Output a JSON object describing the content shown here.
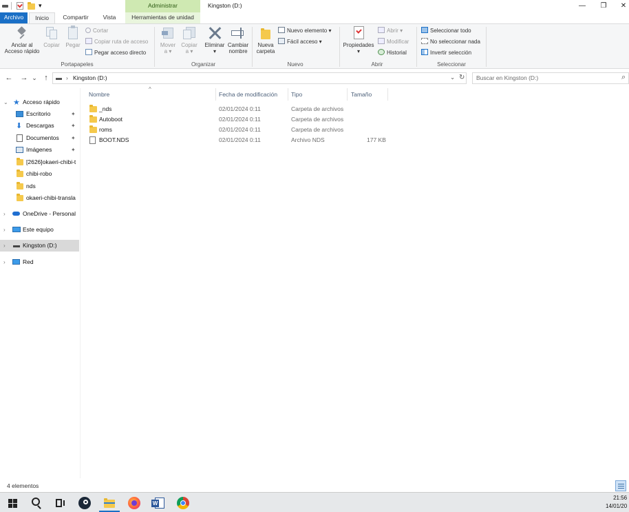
{
  "window": {
    "title": "Kingston (D:)",
    "context_tab_header": "Administrar",
    "minimize_glyph": "—",
    "restore_glyph": "❐",
    "close_glyph": "✕"
  },
  "qat": {
    "dropdown_glyph": "▾"
  },
  "tabs": [
    {
      "label": "Archivo"
    },
    {
      "label": "Inicio"
    },
    {
      "label": "Compartir"
    },
    {
      "label": "Vista"
    },
    {
      "label": "Herramientas de unidad"
    }
  ],
  "ribbon": {
    "clipboard": {
      "pin_label_1": "Anclar al",
      "pin_label_2": "Acceso rápido",
      "copy": "Copiar",
      "paste": "Pegar",
      "cut": "Cortar",
      "copy_path": "Copiar ruta de acceso",
      "paste_shortcut": "Pegar acceso directo",
      "group": "Portapapeles"
    },
    "organize": {
      "move_1": "Mover",
      "move_2": "a ▾",
      "copy_1": "Copiar",
      "copy_2": "a ▾",
      "delete_1": "Eliminar",
      "delete_2": "▾",
      "rename_1": "Cambiar",
      "rename_2": "nombre",
      "group": "Organizar"
    },
    "new": {
      "folder_1": "Nueva",
      "folder_2": "carpeta",
      "new_item": "Nuevo elemento ▾",
      "easy_access": "Fácil acceso ▾",
      "group": "Nuevo"
    },
    "open": {
      "properties": "Propiedades",
      "properties_arrow": "▾",
      "open": "Abrir ▾",
      "edit": "Modificar",
      "history": "Historial",
      "group": "Abrir"
    },
    "select": {
      "select_all": "Seleccionar todo",
      "select_none": "No seleccionar nada",
      "invert": "Invertir selección",
      "group": "Seleccionar"
    }
  },
  "address": {
    "back_glyph": "←",
    "forward_glyph": "→",
    "recent_glyph": "⌄",
    "up_glyph": "↑",
    "crumb_sep": "›",
    "path": "Kingston (D:)",
    "dropdown_glyph": "⌄",
    "refresh_glyph": "↻",
    "search_placeholder": "Buscar en Kingston (D:)",
    "search_glyph": "⌕"
  },
  "nav": {
    "expanded_glyph": "⌄",
    "collapsed_glyph": "›",
    "pin_glyph": "📌",
    "quick_access": "Acceso rápido",
    "items": [
      {
        "label": "Escritorio",
        "pinned": true
      },
      {
        "label": "Descargas",
        "pinned": true
      },
      {
        "label": "Documentos",
        "pinned": true
      },
      {
        "label": "Imágenes",
        "pinned": true
      },
      {
        "label": "[2626]okaeri-chibi-t"
      },
      {
        "label": "chibi-robo"
      },
      {
        "label": "nds"
      },
      {
        "label": "okaeri-chibi-transla"
      }
    ],
    "onedrive": "OneDrive - Personal",
    "this_pc": "Este equipo",
    "drive": "Kingston (D:)",
    "network": "Red"
  },
  "columns": {
    "sort_glyph": "^",
    "name": "Nombre",
    "modified": "Fecha de modificación",
    "type": "Tipo",
    "size": "Tamaño"
  },
  "files": [
    {
      "name": "_nds",
      "modified": "02/01/2024 0:11",
      "type": "Carpeta de archivos",
      "size": "",
      "kind": "folder"
    },
    {
      "name": "Autoboot",
      "modified": "02/01/2024 0:11",
      "type": "Carpeta de archivos",
      "size": "",
      "kind": "folder"
    },
    {
      "name": "roms",
      "modified": "02/01/2024 0:11",
      "type": "Carpeta de archivos",
      "size": "",
      "kind": "folder"
    },
    {
      "name": "BOOT.NDS",
      "modified": "02/01/2024 0:11",
      "type": "Archivo NDS",
      "size": "177 KB",
      "kind": "file"
    }
  ],
  "status": {
    "count": "4 elementos"
  },
  "taskbar": {
    "time": "21:56",
    "date": "14/01/20"
  },
  "colors": {
    "accent": "#1a6fc6",
    "context_tab": "#cfe9b2",
    "folder": "#f5c94c",
    "selected_nav": "#d9d9d9"
  }
}
